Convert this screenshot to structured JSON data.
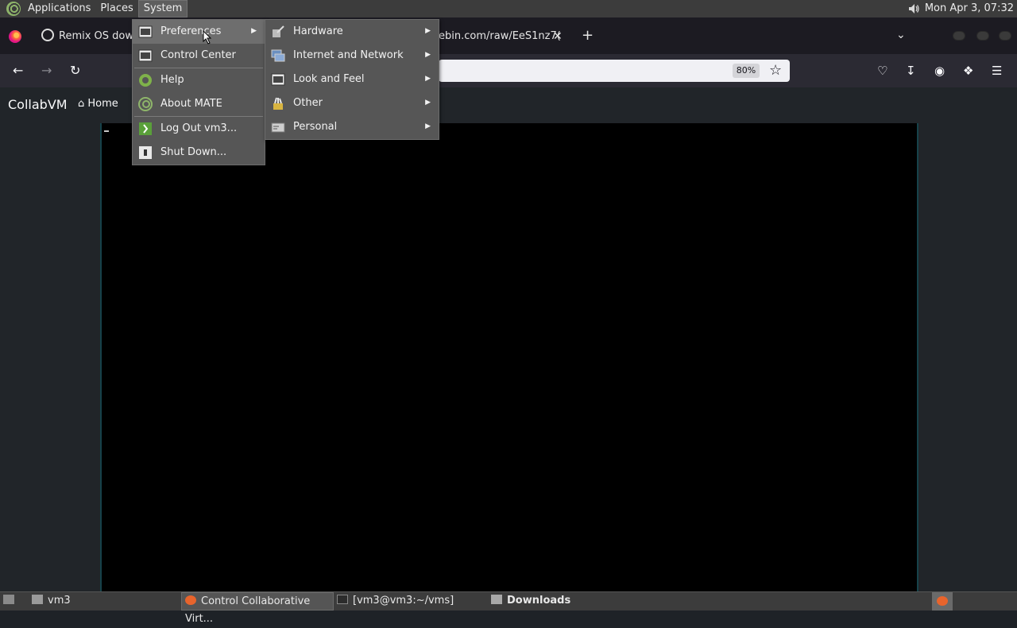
{
  "top_panel": {
    "menus": [
      "Applications",
      "Places",
      "System"
    ],
    "clock": "Mon Apr  3, 07:32"
  },
  "browser": {
    "tabs": [
      {
        "title": "Remix OS dow"
      },
      {
        "title": "ebin.com/raw/EeS1nz7("
      }
    ],
    "zoom": "80%"
  },
  "page": {
    "brand": "CollabVM",
    "home_link": "Home"
  },
  "system_menu": {
    "items": [
      {
        "label": "Preferences",
        "icon": "preferences-icon",
        "has_submenu": true
      },
      {
        "label": "Control Center",
        "icon": "control-center-icon"
      },
      {
        "label": "Help",
        "icon": "help-lifebuoy-icon"
      },
      {
        "label": "About MATE",
        "icon": "mate-logo-icon"
      },
      {
        "label": "Log Out vm3...",
        "icon": "logout-icon"
      },
      {
        "label": "Shut Down...",
        "icon": "shutdown-icon"
      }
    ]
  },
  "preferences_menu": {
    "items": [
      {
        "label": "Hardware",
        "icon": "hardware-icon"
      },
      {
        "label": "Internet and Network",
        "icon": "network-icon"
      },
      {
        "label": "Look and Feel",
        "icon": "look-and-feel-icon"
      },
      {
        "label": "Other",
        "icon": "other-icon"
      },
      {
        "label": "Personal",
        "icon": "personal-icon"
      }
    ]
  },
  "bottom_panel": {
    "workspace": "vm3",
    "tasks": [
      {
        "label": "Control Collaborative Virt..."
      },
      {
        "label": "[vm3@vm3:~/vms]"
      },
      {
        "label": "Downloads"
      }
    ]
  },
  "colors": {
    "panel": "#3c3c3c",
    "menu_bg": "#565656",
    "menu_highlight": "#6e6e6e",
    "firefox_toolbar": "#2b2a33",
    "page_bg": "#212529",
    "vm_border": "#16424a"
  }
}
